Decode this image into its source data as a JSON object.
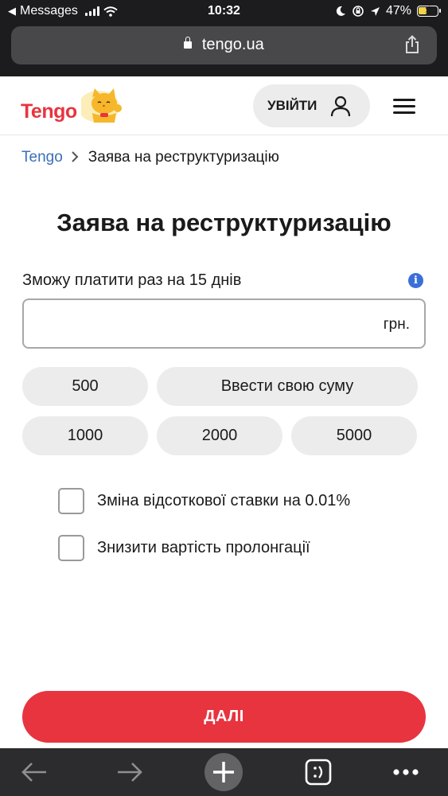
{
  "status_bar": {
    "back_app": "Messages",
    "time": "10:32",
    "battery": "47%",
    "battery_level": 0.47
  },
  "browser": {
    "url": "tengo.ua"
  },
  "header": {
    "logo_text": "Tengo",
    "login_label": "УВІЙТИ"
  },
  "breadcrumb": {
    "home": "Tengo",
    "current": "Заява на реструктуризацію"
  },
  "page_title": "Заява на реструктуризацію",
  "form": {
    "label": "Зможу платити раз на 15 днів",
    "info": "i",
    "amount_value": "",
    "currency": "грн.",
    "chips_row1": [
      "500",
      "Ввести свою суму"
    ],
    "chips_row2": [
      "1000",
      "2000",
      "5000"
    ],
    "options": [
      {
        "label": "Зміна відсоткової ставки на 0.01%",
        "checked": false
      },
      {
        "label": "Знизити вартість пролонгації",
        "checked": false
      }
    ],
    "next_label": "ДАЛІ"
  },
  "colors": {
    "accent": "#e8343f",
    "link": "#3a6fb8",
    "chip": "#ececec"
  }
}
